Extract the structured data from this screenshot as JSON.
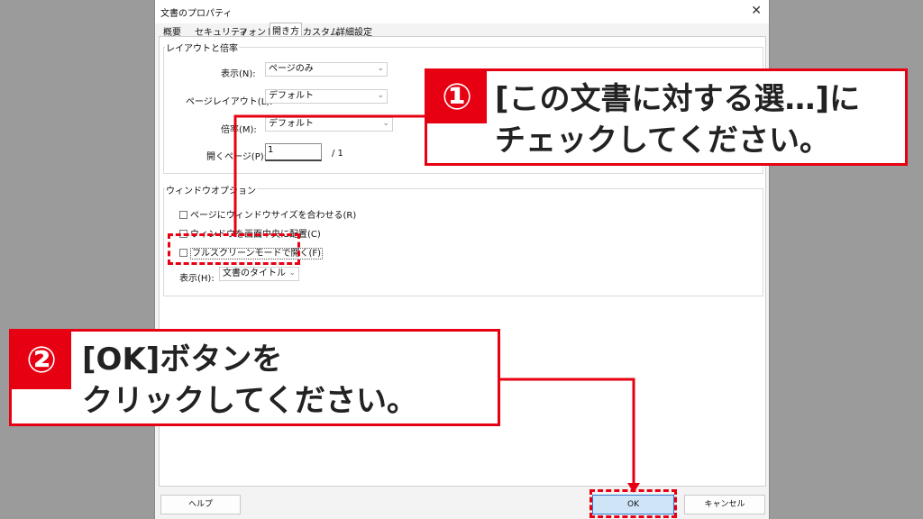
{
  "dialog": {
    "title": "文書のプロパティ",
    "close_symbol": "✕",
    "tabs": [
      "概要",
      "セキュリティ",
      "フォント",
      "開き方",
      "カスタム",
      "詳細設定"
    ],
    "layout_group": {
      "label": "レイアウトと倍率",
      "display_label": "表示(N):",
      "display_value": "ページのみ",
      "page_layout_label": "ページレイアウト(L):",
      "page_layout_value": "デフォルト",
      "zoom_label": "倍率(M):",
      "zoom_value": "デフォルト",
      "open_page_label": "開くページ(P):",
      "open_page_value": "1",
      "page_total": "/ 1"
    },
    "window_group": {
      "label": "ウィンドウオプション",
      "resize_label": "ページにウィンドウサイズを合わせる(R)",
      "center_label": "ウィンドウを画面中央に配置(C)",
      "fullscreen_label": "フルスクリーンモードで開く(F)",
      "show_label": "表示(H):",
      "show_value": "文書のタイトル"
    },
    "buttons": {
      "help": "ヘルプ",
      "ok": "OK",
      "cancel": "キャンセル"
    }
  },
  "callouts": [
    {
      "number": "①",
      "text": "[この文書に対する選…]に\nチェックしてください。"
    },
    {
      "number": "②",
      "text": "[OK]ボタンを\nクリックしてください。"
    }
  ],
  "colors": {
    "accent": "#e60012",
    "ok_button": "#cfe4f7"
  }
}
